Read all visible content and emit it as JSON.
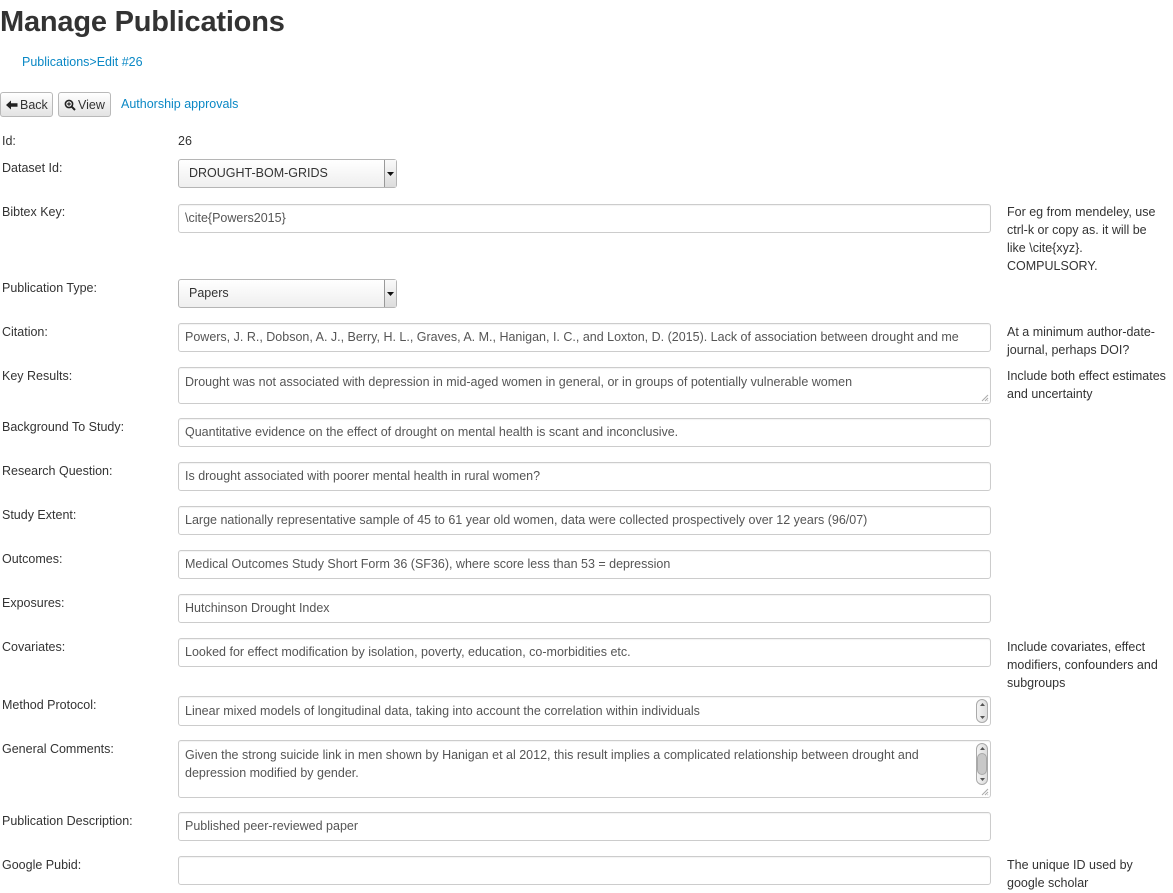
{
  "page": {
    "title": "Manage Publications",
    "breadcrumb": {
      "parent": "Publications",
      "separator": ">",
      "current": "Edit #26"
    }
  },
  "toolbar": {
    "back_label": "Back",
    "view_label": "View",
    "approvals_link": "Authorship approvals"
  },
  "form": {
    "id": {
      "label": "Id:",
      "value": "26"
    },
    "dataset_id": {
      "label": "Dataset Id:",
      "value": "DROUGHT-BOM-GRIDS"
    },
    "bibtex_key": {
      "label": "Bibtex Key:",
      "value": "\\cite{Powers2015}",
      "help": "For eg from mendeley, use ctrl-k or copy as. it will be like \\cite{xyz}. COMPULSORY."
    },
    "publication_type": {
      "label": "Publication Type:",
      "value": "Papers"
    },
    "citation": {
      "label": "Citation:",
      "value": "Powers, J. R., Dobson, A. J., Berry, H. L., Graves, A. M., Hanigan, I. C., and Loxton, D. (2015). Lack of association between drought and me",
      "help": "At a minimum author-date-journal, perhaps DOI?"
    },
    "key_results": {
      "label": "Key Results:",
      "value": "Drought was not associated with depression in mid-aged women in general, or in groups of potentially vulnerable women",
      "help": "Include both effect estimates and uncertainty"
    },
    "background": {
      "label": "Background To Study:",
      "value": "Quantitative evidence on the effect of drought on mental health is scant and inconclusive."
    },
    "research_question": {
      "label": "Research Question:",
      "value": "Is drought associated with poorer mental health in rural women?"
    },
    "study_extent": {
      "label": "Study Extent:",
      "value": "Large nationally representative sample of 45 to 61 year old women, data were collected prospectively over 12 years (96/07)"
    },
    "outcomes": {
      "label": "Outcomes:",
      "value": "Medical Outcomes Study Short Form 36 (SF36), where score less than 53 = depression"
    },
    "exposures": {
      "label": "Exposures:",
      "value": "Hutchinson Drought Index"
    },
    "covariates": {
      "label": "Covariates:",
      "value": "Looked for effect modification by isolation, poverty, education, co-morbidities etc.",
      "help": "Include covariates, effect modifiers, confounders and subgroups"
    },
    "method_protocol": {
      "label": "Method Protocol:",
      "value": "Linear mixed models of longitudinal data, taking into account the correlation within individuals"
    },
    "general_comments": {
      "label": "General Comments:",
      "value": "Given the strong suicide link in men shown by Hanigan et al 2012, this result implies a complicated relationship between drought and depression modified by gender."
    },
    "publication_description": {
      "label": "Publication Description:",
      "value": "Published peer-reviewed paper"
    },
    "google_pubid": {
      "label": "Google Pubid:",
      "value": "",
      "help": "The unique ID used by google scholar"
    }
  }
}
